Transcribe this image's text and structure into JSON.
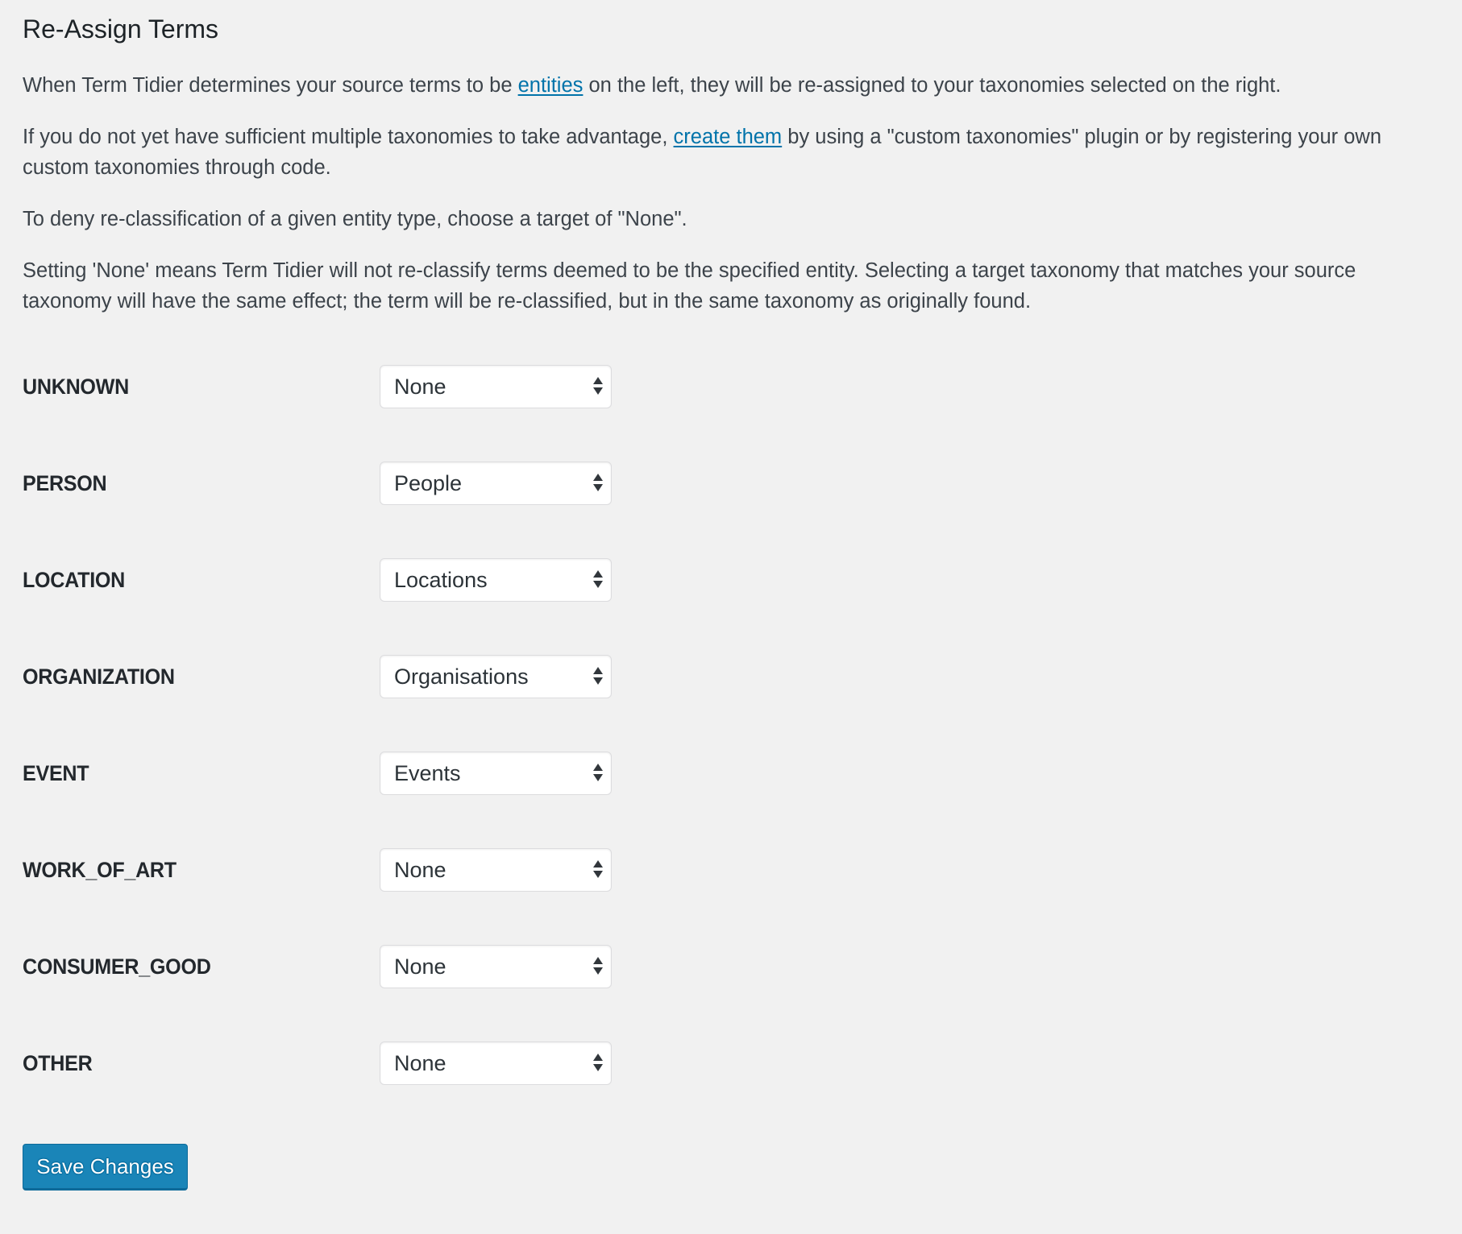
{
  "page": {
    "title": "Re-Assign Terms",
    "colors": {
      "background": "#f1f1f1",
      "link": "#0073aa",
      "primary_button": "#1a85b8",
      "primary_button_border": "#0e6a99",
      "text": "#3c434a"
    }
  },
  "intro": {
    "p1": {
      "before": "When Term Tidier determines your source terms to be ",
      "link": "entities",
      "after": " on the left, they will be re-assigned to your taxonomies selected on the right."
    },
    "p2": {
      "before": "If you do not yet have sufficient multiple taxonomies to take advantage, ",
      "link": "create them",
      "after": " by using a \"custom taxonomies\" plugin or by registering your own",
      "line2": "custom taxonomies through code."
    },
    "p3": "To deny re-classification of a given entity type, choose a target of \"None\".",
    "p4": {
      "line1": "Setting 'None' means Term Tidier will not re-classify terms deemed to be the specified entity. Selecting a target taxonomy that matches your source",
      "line2": "taxonomy will have the same effect; the term will be re-classified, but in the same taxonomy as originally found."
    }
  },
  "mappings": [
    {
      "entity": "UNKNOWN",
      "target": "None"
    },
    {
      "entity": "PERSON",
      "target": "People"
    },
    {
      "entity": "LOCATION",
      "target": "Locations"
    },
    {
      "entity": "ORGANIZATION",
      "target": "Organisations"
    },
    {
      "entity": "EVENT",
      "target": "Events"
    },
    {
      "entity": "WORK_OF_ART",
      "target": "None"
    },
    {
      "entity": "CONSUMER_GOOD",
      "target": "None"
    },
    {
      "entity": "OTHER",
      "target": "None"
    }
  ],
  "actions": {
    "save_label": "Save Changes"
  }
}
